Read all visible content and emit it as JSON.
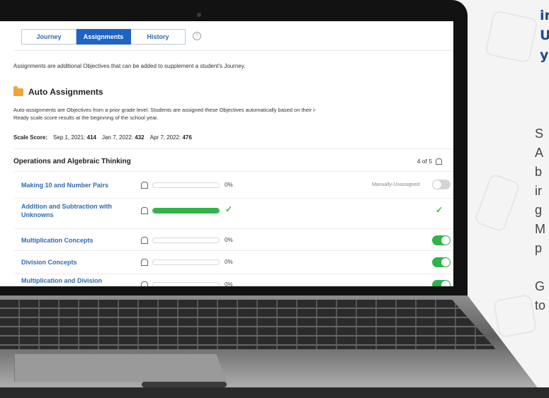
{
  "tabs": [
    {
      "label": "Journey",
      "active": false
    },
    {
      "label": "Assignments",
      "active": true
    },
    {
      "label": "History",
      "active": false
    }
  ],
  "help_icon": "?",
  "intro_text": "Assignments are additional Objectives that can be added to supplement a student's Journey.",
  "auto_assignments": {
    "icon": "folder-icon",
    "title": "Auto Assignments",
    "description": "Auto-assignments are Objectives from a prior grade level. Students are assigned these Objectives automatically based on their i-Ready scale score results at the beginning of the school year."
  },
  "scale_score": {
    "label": "Scale Score:",
    "entries": [
      {
        "date": "Sep 1, 2021:",
        "value": "414"
      },
      {
        "date": "Jan 7, 2022:",
        "value": "432"
      },
      {
        "date": "Apr 7, 2022:",
        "value": "476"
      }
    ]
  },
  "section": {
    "title": "Operations and Algebraic Thinking",
    "count": "4 of 5"
  },
  "objectives": [
    {
      "name": "Making 10 and Number Pairs",
      "progress": 0,
      "pct": "0%",
      "status_text": "Manually-Unassigned",
      "toggle": "off",
      "completed": false
    },
    {
      "name": "Addition and Subtraction with Unknowns",
      "progress": 100,
      "pct": "",
      "status_text": "",
      "toggle": "none",
      "completed": true
    },
    {
      "name": "Multiplication Concepts",
      "progress": 0,
      "pct": "0%",
      "status_text": "",
      "toggle": "on",
      "completed": false
    },
    {
      "name": "Division Concepts",
      "progress": 0,
      "pct": "0%",
      "status_text": "",
      "toggle": "on",
      "completed": false
    },
    {
      "name": "Multiplication and Division Relationships",
      "progress": 0,
      "pct": "0%",
      "status_text": "",
      "toggle": "on",
      "completed": false
    }
  ],
  "side_text": {
    "heading": [
      "ir",
      "U",
      "y"
    ],
    "body": [
      "S",
      "A",
      "b",
      "ir",
      "g",
      "M",
      "p",
      "",
      "G",
      "to"
    ]
  },
  "colors": {
    "accent": "#1f64c2",
    "link": "#2f6bb0",
    "success": "#2fb44a",
    "heading": "#1f4a8a"
  }
}
